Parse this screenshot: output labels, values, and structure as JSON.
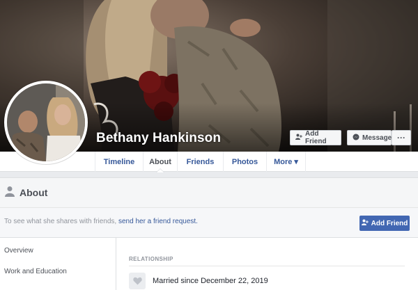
{
  "profile": {
    "name": "Bethany Hankinson"
  },
  "cover_actions": {
    "add_friend": "Add Friend",
    "message": "Message",
    "more": "···"
  },
  "tabs": [
    {
      "label": "Timeline",
      "active": false
    },
    {
      "label": "About",
      "active": true
    },
    {
      "label": "Friends",
      "active": false
    },
    {
      "label": "Photos",
      "active": false
    },
    {
      "label": "More ▾",
      "active": false
    }
  ],
  "about": {
    "title": "About",
    "friend_request_text": "To see what she shares with friends,",
    "friend_request_link": "send her a friend request.",
    "add_friend_button": "Add Friend",
    "sidebar": [
      "Overview",
      "Work and Education"
    ],
    "section_label": "RELATIONSHIP",
    "relationship": "Married since December 22, 2019"
  },
  "icons": {
    "person": "person-icon",
    "add_friend": "person-plus-icon",
    "messenger": "messenger-icon",
    "heart": "heart-icon"
  },
  "colors": {
    "link": "#365899",
    "primary_button": "#4267b2",
    "background": "#e9ebee"
  }
}
